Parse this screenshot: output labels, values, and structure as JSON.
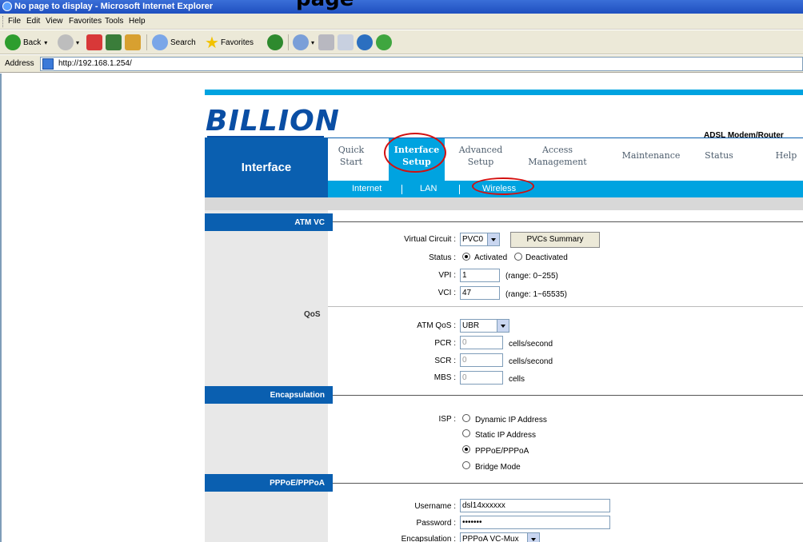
{
  "window": {
    "title": "No page to display - Microsoft Internet Explorer"
  },
  "menu": [
    "File",
    "Edit",
    "View",
    "Favorites",
    "Tools",
    "Help"
  ],
  "toolbar": {
    "back": "Back",
    "search": "Search",
    "favorites": "Favorites"
  },
  "address": {
    "label": "Address",
    "url": "http://192.168.1.254/"
  },
  "router": {
    "logo": "BILLION",
    "model": "ADSL Modem/Router",
    "section": "Interface",
    "nav": [
      {
        "line1": "Quick",
        "line2": "Start"
      },
      {
        "line1": "Interface",
        "line2": "Setup"
      },
      {
        "line1": "Advanced",
        "line2": "Setup"
      },
      {
        "line1": "Access",
        "line2": "Management"
      },
      {
        "line1": "Maintenance",
        "line2": ""
      },
      {
        "line1": "Status",
        "line2": ""
      },
      {
        "line1": "Help",
        "line2": ""
      }
    ],
    "subnav": [
      "Internet",
      "LAN",
      "Wireless"
    ]
  },
  "atm": {
    "header": "ATM VC",
    "virtual_circuit_label": "Virtual Circuit :",
    "virtual_circuit_value": "PVC0",
    "summary_button": "PVCs Summary",
    "status_label": "Status :",
    "status_activated": "Activated",
    "status_deactivated": "Deactivated",
    "vpi_label": "VPI :",
    "vpi_value": "1",
    "vpi_hint": "(range: 0~255)",
    "vci_label": "VCI :",
    "vci_value": "47",
    "vci_hint": "(range: 1~65535)"
  },
  "qos": {
    "label": "QoS",
    "atm_qos_label": "ATM QoS :",
    "atm_qos_value": "UBR",
    "pcr_label": "PCR :",
    "pcr_value": "0",
    "scr_label": "SCR :",
    "scr_value": "0",
    "mbs_label": "MBS :",
    "mbs_value": "0",
    "unit_cells_per_second": "cells/second",
    "unit_cells": "cells"
  },
  "encapsulation": {
    "header": "Encapsulation",
    "isp_label": "ISP :",
    "options": [
      "Dynamic IP Address",
      "Static IP Address",
      "PPPoE/PPPoA",
      "Bridge Mode"
    ],
    "selected": "PPPoE/PPPoA"
  },
  "pppoe": {
    "header": "PPPoE/PPPoA",
    "username_label": "Username :",
    "username_value": "dsl14xxxxxx",
    "password_label": "Password :",
    "password_value": "•••••••",
    "encap_label": "Encapsulation :",
    "encap_value": "PPPoA VC-Mux"
  },
  "colors": {
    "accent": "#00a3e0",
    "nav_dark": "#0a5fb0",
    "annotation": "#d21010"
  }
}
